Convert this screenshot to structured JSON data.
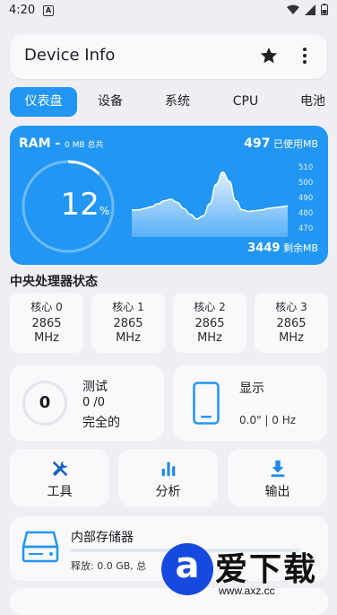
{
  "status_bar": {
    "time": "4:20",
    "notification_glyph": "A"
  },
  "app_bar": {
    "title": "Device Info",
    "icons": [
      "star-icon",
      "more-vert-icon"
    ]
  },
  "tabs": [
    {
      "label": "仪表盘",
      "active": true
    },
    {
      "label": "设备",
      "active": false
    },
    {
      "label": "系统",
      "active": false
    },
    {
      "label": "CPU",
      "active": false
    },
    {
      "label": "电池",
      "active": false
    }
  ],
  "ram": {
    "label": "RAM - ",
    "total": "0 MB 总共",
    "used_value": "497",
    "used_unit": " 已使用MB",
    "percent_value": "12",
    "percent_unit": "%",
    "percent": 12,
    "free_value": "3449",
    "free_unit": " 剩余MB",
    "accent_color": "#2196f3"
  },
  "chart_data": {
    "type": "area",
    "title": "",
    "xlabel": "",
    "ylabel": "",
    "ylim": [
      465,
      515
    ],
    "y_ticks": [
      "510",
      "500",
      "490",
      "480",
      "470"
    ],
    "y_tick_values": [
      510,
      500,
      490,
      480,
      470
    ],
    "series": [
      {
        "values": [
          483,
          483,
          484,
          485,
          487,
          489,
          490,
          488,
          484,
          480,
          477,
          479,
          487,
          500,
          508,
          502,
          489,
          483,
          482,
          482.5,
          483,
          484,
          484.5,
          485,
          485.5
        ]
      }
    ]
  },
  "cpu_section": {
    "title": "中央处理器状态",
    "cores": [
      {
        "label": "核心 0",
        "freq_line1": "2865",
        "freq_line2": "MHz"
      },
      {
        "label": "核心 1",
        "freq_line1": "2865",
        "freq_line2": "MHz"
      },
      {
        "label": "核心 2",
        "freq_line1": "2865",
        "freq_line2": "MHz"
      },
      {
        "label": "核心 3",
        "freq_line1": "2865",
        "freq_line2": "MHz"
      }
    ]
  },
  "test_card": {
    "count": "0",
    "title": "测试",
    "progress": "0 /0",
    "status": "完全的"
  },
  "display_card": {
    "title": "显示",
    "value": "0.0\" | 0 Hz",
    "icon": "phone-icon"
  },
  "actions": [
    {
      "label": "工具",
      "icon": "tools-icon"
    },
    {
      "label": "分析",
      "icon": "bar-chart-icon"
    },
    {
      "label": "输出",
      "icon": "download-icon"
    }
  ],
  "storage": {
    "title": "内部存储器",
    "detail": "释放: 0.0 GB, 总",
    "icon": "storage-drive-icon",
    "accent_color": "#2196f3"
  },
  "watermark": {
    "logo_letter": "a",
    "text": "爱下载",
    "url": "www.axz.cc"
  }
}
